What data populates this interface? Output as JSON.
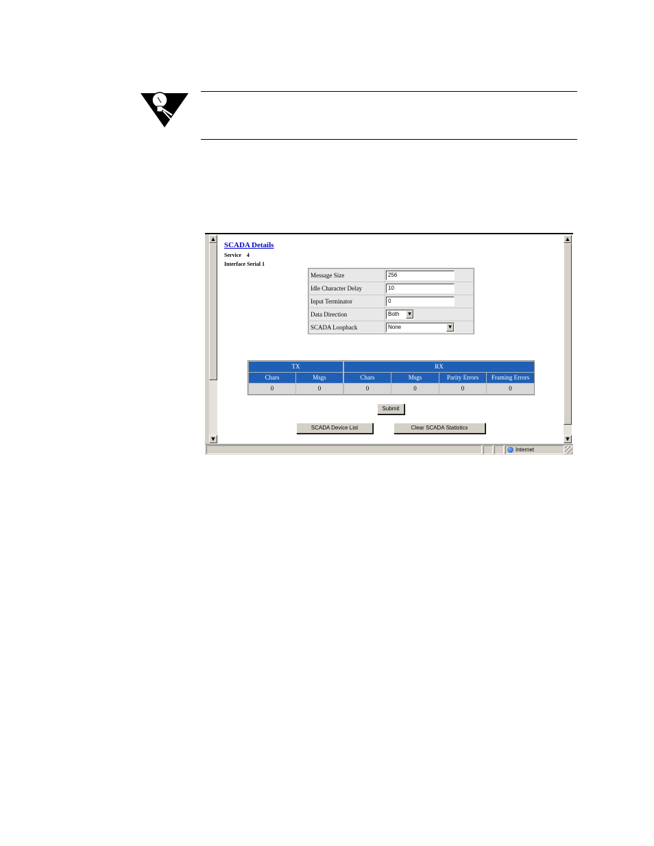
{
  "page": {
    "title": "SCADA Details",
    "service_label": "Service",
    "service_value": "4",
    "interface_label": "Interface",
    "interface_value": "Serial 1"
  },
  "config": [
    {
      "label": "Message Size",
      "value": "256",
      "kind": "input"
    },
    {
      "label": "Idle Character Delay",
      "value": "10",
      "kind": "input"
    },
    {
      "label": "Input Terminator",
      "value": "0",
      "kind": "input"
    },
    {
      "label": "Data Direction",
      "value": "Both",
      "kind": "select"
    },
    {
      "label": "SCADA Loopback",
      "value": "None",
      "kind": "select"
    }
  ],
  "stats": {
    "groups": [
      "TX",
      "RX"
    ],
    "headers": [
      "Chars",
      "Msgs",
      "Chars",
      "Msgs",
      "Parity Errors",
      "Framing Errors"
    ],
    "values": [
      "0",
      "0",
      "0",
      "0",
      "0",
      "0"
    ]
  },
  "buttons": {
    "submit": "Submit",
    "device_list": "SCADA Device List",
    "clear_stats": "Clear SCADA Statistics"
  },
  "status": {
    "zone": "Internet"
  },
  "icons": {
    "note": "lightbulb-icon",
    "zone": "globe-icon",
    "scroll_up": "scroll-up-arrow-icon",
    "scroll_down": "scroll-down-arrow-icon",
    "dropdown": "chevron-down-icon"
  },
  "colors": {
    "table_header": "#1f5fb5",
    "link": "#0000cc",
    "chrome": "#d4d0c8"
  }
}
